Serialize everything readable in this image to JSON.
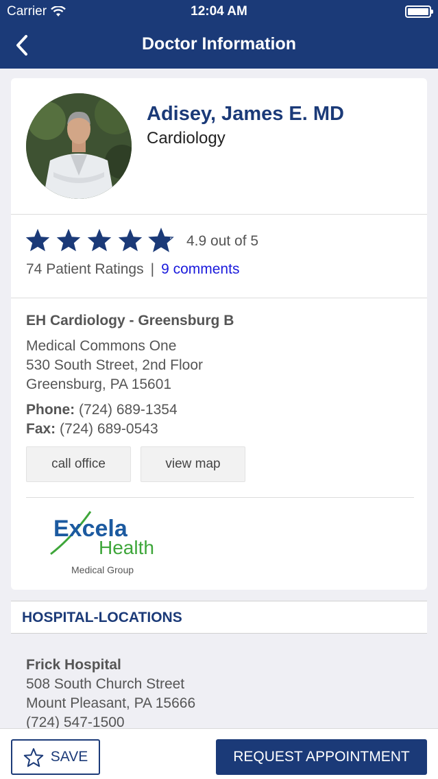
{
  "status_bar": {
    "carrier": "Carrier",
    "time": "12:04 AM"
  },
  "nav": {
    "title": "Doctor Information"
  },
  "doctor": {
    "name": "Adisey, James E. MD",
    "specialty": "Cardiology"
  },
  "rating": {
    "stars_value": 4.9,
    "text": "4.9 out of 5",
    "patient_ratings": "74 Patient Ratings",
    "separator": "|",
    "comments_link": "9 comments"
  },
  "office": {
    "name": "EH Cardiology - Greensburg B",
    "address_lines": [
      "Medical Commons One",
      "530 South Street, 2nd Floor",
      "Greensburg, PA 15601"
    ],
    "phone_label": "Phone:",
    "phone": "(724) 689-1354",
    "fax_label": "Fax:",
    "fax": "(724) 689-0543",
    "call_button": "call office",
    "map_button": "view map"
  },
  "logo": {
    "line1": "Excela",
    "line2": "Health",
    "line3": "Medical Group"
  },
  "hospital_section": {
    "title": "HOSPITAL-LOCATIONS",
    "name": "Frick Hospital",
    "address_lines": [
      "508 South Church Street",
      "Mount Pleasant, PA 15666",
      "(724) 547-1500"
    ]
  },
  "bottom": {
    "save_label": "SAVE",
    "request_label": "REQUEST APPOINTMENT"
  },
  "colors": {
    "primary": "#1b3a78",
    "link": "#1a1adc",
    "background": "#efeff4"
  }
}
